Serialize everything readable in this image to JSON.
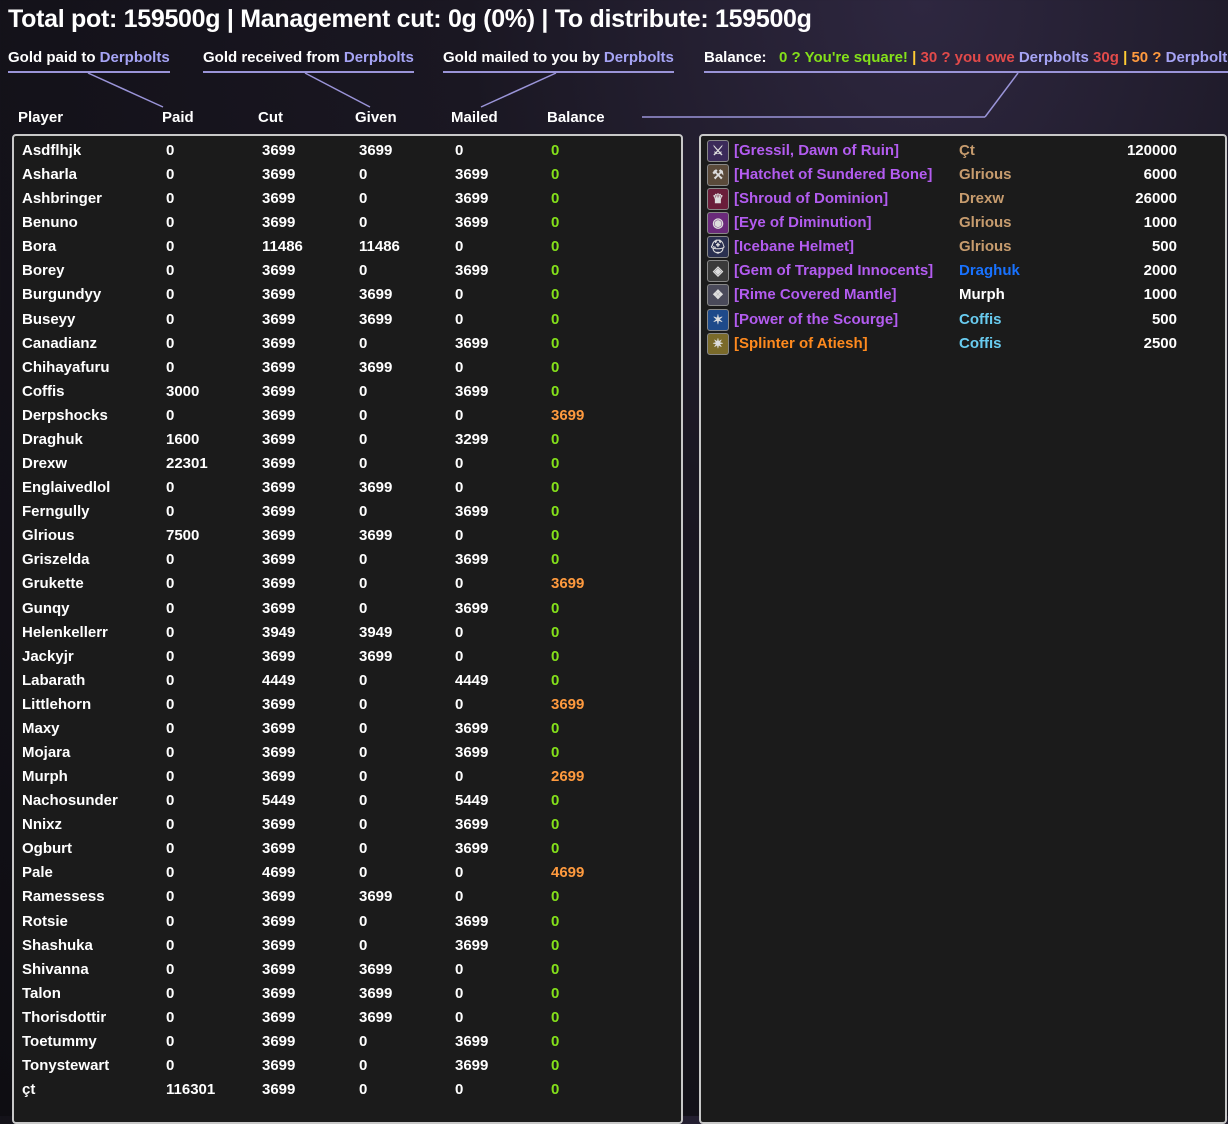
{
  "title": "Total pot: 159500g | Management cut: 0g (0%) | To distribute: 159500g",
  "legend": {
    "paid_prefix": "Gold paid to ",
    "received_prefix": "Gold received from ",
    "mailed_prefix": "Gold mailed to you by ",
    "banker": "Derpbolts",
    "balance_label": "Balance:",
    "square_text": "0 ? You're square!",
    "owe_text": "30 ? you owe ",
    "owe_amount": "30g",
    "owes_you_text": "50 ? ",
    "pipe": "|"
  },
  "columns": [
    "Player",
    "Paid",
    "Cut",
    "Given",
    "Mailed",
    "Balance"
  ],
  "colors": {
    "highlight": "#a6a4f5",
    "balance_zero": "#84e01a",
    "balance_owe": "#ff9a3e",
    "epic": "#b35cf0",
    "legendary": "#ff8a1e"
  },
  "players": [
    {
      "name": "Asdflhjk",
      "paid": "0",
      "cut": "3699",
      "given": "3699",
      "mailed": "0",
      "balance": "0"
    },
    {
      "name": "Asharla",
      "paid": "0",
      "cut": "3699",
      "given": "0",
      "mailed": "3699",
      "balance": "0"
    },
    {
      "name": "Ashbringer",
      "paid": "0",
      "cut": "3699",
      "given": "0",
      "mailed": "3699",
      "balance": "0"
    },
    {
      "name": "Benuno",
      "paid": "0",
      "cut": "3699",
      "given": "0",
      "mailed": "3699",
      "balance": "0"
    },
    {
      "name": "Bora",
      "paid": "0",
      "cut": "11486",
      "given": "11486",
      "mailed": "0",
      "balance": "0"
    },
    {
      "name": "Borey",
      "paid": "0",
      "cut": "3699",
      "given": "0",
      "mailed": "3699",
      "balance": "0"
    },
    {
      "name": "Burgundyy",
      "paid": "0",
      "cut": "3699",
      "given": "3699",
      "mailed": "0",
      "balance": "0"
    },
    {
      "name": "Buseyy",
      "paid": "0",
      "cut": "3699",
      "given": "3699",
      "mailed": "0",
      "balance": "0"
    },
    {
      "name": "Canadianz",
      "paid": "0",
      "cut": "3699",
      "given": "0",
      "mailed": "3699",
      "balance": "0"
    },
    {
      "name": "Chihayafuru",
      "paid": "0",
      "cut": "3699",
      "given": "3699",
      "mailed": "0",
      "balance": "0"
    },
    {
      "name": "Coffis",
      "paid": "3000",
      "cut": "3699",
      "given": "0",
      "mailed": "3699",
      "balance": "0"
    },
    {
      "name": "Derpshocks",
      "paid": "0",
      "cut": "3699",
      "given": "0",
      "mailed": "0",
      "balance": "3699"
    },
    {
      "name": "Draghuk",
      "paid": "1600",
      "cut": "3699",
      "given": "0",
      "mailed": "3299",
      "balance": "0"
    },
    {
      "name": "Drexw",
      "paid": "22301",
      "cut": "3699",
      "given": "0",
      "mailed": "0",
      "balance": "0"
    },
    {
      "name": "Englaivedlol",
      "paid": "0",
      "cut": "3699",
      "given": "3699",
      "mailed": "0",
      "balance": "0"
    },
    {
      "name": "Ferngully",
      "paid": "0",
      "cut": "3699",
      "given": "0",
      "mailed": "3699",
      "balance": "0"
    },
    {
      "name": "Glrious",
      "paid": "7500",
      "cut": "3699",
      "given": "3699",
      "mailed": "0",
      "balance": "0"
    },
    {
      "name": "Griszelda",
      "paid": "0",
      "cut": "3699",
      "given": "0",
      "mailed": "3699",
      "balance": "0"
    },
    {
      "name": "Grukette",
      "paid": "0",
      "cut": "3699",
      "given": "0",
      "mailed": "0",
      "balance": "3699"
    },
    {
      "name": "Gunqy",
      "paid": "0",
      "cut": "3699",
      "given": "0",
      "mailed": "3699",
      "balance": "0"
    },
    {
      "name": "Helenkellerr",
      "paid": "0",
      "cut": "3949",
      "given": "3949",
      "mailed": "0",
      "balance": "0"
    },
    {
      "name": "Jackyjr",
      "paid": "0",
      "cut": "3699",
      "given": "3699",
      "mailed": "0",
      "balance": "0"
    },
    {
      "name": "Labarath",
      "paid": "0",
      "cut": "4449",
      "given": "0",
      "mailed": "4449",
      "balance": "0"
    },
    {
      "name": "Littlehorn",
      "paid": "0",
      "cut": "3699",
      "given": "0",
      "mailed": "0",
      "balance": "3699"
    },
    {
      "name": "Maxy",
      "paid": "0",
      "cut": "3699",
      "given": "0",
      "mailed": "3699",
      "balance": "0"
    },
    {
      "name": "Mojara",
      "paid": "0",
      "cut": "3699",
      "given": "0",
      "mailed": "3699",
      "balance": "0"
    },
    {
      "name": "Murph",
      "paid": "0",
      "cut": "3699",
      "given": "0",
      "mailed": "0",
      "balance": "2699"
    },
    {
      "name": "Nachosunder",
      "paid": "0",
      "cut": "5449",
      "given": "0",
      "mailed": "5449",
      "balance": "0"
    },
    {
      "name": "Nnixz",
      "paid": "0",
      "cut": "3699",
      "given": "0",
      "mailed": "3699",
      "balance": "0"
    },
    {
      "name": "Ogburt",
      "paid": "0",
      "cut": "3699",
      "given": "0",
      "mailed": "3699",
      "balance": "0"
    },
    {
      "name": "Pale",
      "paid": "0",
      "cut": "4699",
      "given": "0",
      "mailed": "0",
      "balance": "4699"
    },
    {
      "name": "Ramessess",
      "paid": "0",
      "cut": "3699",
      "given": "3699",
      "mailed": "0",
      "balance": "0"
    },
    {
      "name": "Rotsie",
      "paid": "0",
      "cut": "3699",
      "given": "0",
      "mailed": "3699",
      "balance": "0"
    },
    {
      "name": "Shashuka",
      "paid": "0",
      "cut": "3699",
      "given": "0",
      "mailed": "3699",
      "balance": "0"
    },
    {
      "name": "Shivanna",
      "paid": "0",
      "cut": "3699",
      "given": "3699",
      "mailed": "0",
      "balance": "0"
    },
    {
      "name": "Talon",
      "paid": "0",
      "cut": "3699",
      "given": "3699",
      "mailed": "0",
      "balance": "0"
    },
    {
      "name": "Thorisdottir",
      "paid": "0",
      "cut": "3699",
      "given": "3699",
      "mailed": "0",
      "balance": "0"
    },
    {
      "name": "Toetummy",
      "paid": "0",
      "cut": "3699",
      "given": "0",
      "mailed": "3699",
      "balance": "0"
    },
    {
      "name": "Tonystewart",
      "paid": "0",
      "cut": "3699",
      "given": "0",
      "mailed": "3699",
      "balance": "0"
    },
    {
      "name": "çt",
      "paid": "116301",
      "cut": "3699",
      "given": "0",
      "mailed": "0",
      "balance": "0"
    }
  ],
  "loot": [
    {
      "item": "[Gressil, Dawn of Ruin]",
      "winner": "Çt",
      "amount": "120000",
      "quality": "epic",
      "winner_class": "cls-warrior",
      "icon": "sword-icon"
    },
    {
      "item": "[Hatchet of Sundered Bone]",
      "winner": "Glrious",
      "amount": "6000",
      "quality": "epic",
      "winner_class": "cls-warrior",
      "icon": "axe-icon"
    },
    {
      "item": "[Shroud of Dominion]",
      "winner": "Drexw",
      "amount": "26000",
      "quality": "epic",
      "winner_class": "cls-warrior",
      "icon": "cloak-icon"
    },
    {
      "item": "[Eye of Diminution]",
      "winner": "Glrious",
      "amount": "1000",
      "quality": "epic",
      "winner_class": "cls-warrior",
      "icon": "eye-icon"
    },
    {
      "item": "[Icebane Helmet]",
      "winner": "Glrious",
      "amount": "500",
      "quality": "epic",
      "winner_class": "cls-warrior",
      "icon": "helmet-icon"
    },
    {
      "item": "[Gem of Trapped Innocents]",
      "winner": "Draghuk",
      "amount": "2000",
      "quality": "epic",
      "winner_class": "cls-shaman",
      "icon": "gem-icon"
    },
    {
      "item": "[Rime Covered Mantle]",
      "winner": "Murph",
      "amount": "1000",
      "quality": "epic",
      "winner_class": "cls-priest",
      "icon": "mantle-icon"
    },
    {
      "item": "[Power of the Scourge]",
      "winner": "Coffis",
      "amount": "500",
      "quality": "epic",
      "winner_class": "cls-mage",
      "icon": "rune-icon"
    },
    {
      "item": "[Splinter of Atiesh]",
      "winner": "Coffis",
      "amount": "2500",
      "quality": "legendary",
      "winner_class": "cls-mage",
      "icon": "splinter-icon"
    }
  ]
}
